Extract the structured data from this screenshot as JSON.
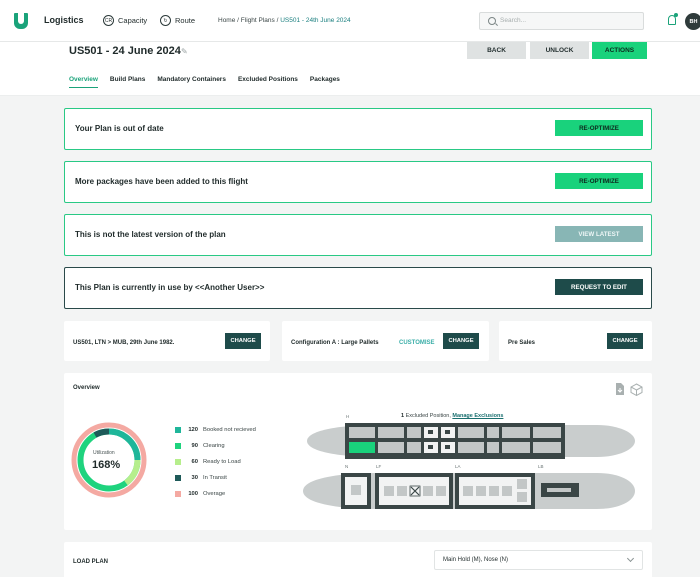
{
  "nav": {
    "app_name": "Logistics",
    "links": [
      {
        "label": "Capacity",
        "icon": "capacity-icon"
      },
      {
        "label": "Route",
        "icon": "route-icon"
      }
    ],
    "breadcrumb": {
      "home": "Home",
      "sep": "/",
      "flight_plans": "Flight Plans",
      "current": "US501 - 24th June 2024"
    },
    "search_placeholder": "Search...",
    "avatar_initials": "BH"
  },
  "header": {
    "title": "US501 - 24 June 2024",
    "buttons": {
      "back": "BACK",
      "unlock": "UNLOCK",
      "actions": "ACTIONS"
    },
    "tabs": [
      "Overview",
      "Build Plans",
      "Mandatory Containers",
      "Excluded Positions",
      "Packages"
    ],
    "active_tab": "Overview"
  },
  "banners": [
    {
      "message": "Your Plan is out of date",
      "action": "RE-OPTIMIZE"
    },
    {
      "message": "More packages have been added to this flight",
      "action": "RE-OPTIMIZE"
    },
    {
      "message": "This is not the latest version of the plan",
      "action": "VIEW LATEST"
    },
    {
      "message": "This Plan is currently in use by <<Another User>>",
      "action": "REQUEST TO EDIT"
    }
  ],
  "info_cards": {
    "flight": {
      "text": "US501, LTN > MUB, 29th June 1982.",
      "button": "CHANGE"
    },
    "configuration": {
      "text": "Configuration A : Large Pallets",
      "link": "CUSTOMISE",
      "button": "CHANGE"
    },
    "pre_sales": {
      "text": "Pre Sales",
      "button": "CHANGE"
    }
  },
  "overview": {
    "title": "Overview",
    "utilization_label": "Utilization",
    "utilization_value": "168%",
    "legend": [
      {
        "count": "120",
        "label": "Booked not recieved",
        "color": "#1fb69a"
      },
      {
        "count": "90",
        "label": "Clearing",
        "color": "#1fd37e"
      },
      {
        "count": "60",
        "label": "Ready to Load",
        "color": "#b6ee8c"
      },
      {
        "count": "30",
        "label": "In Transit",
        "color": "#1e5a59"
      },
      {
        "count": "100",
        "label": "Overage",
        "color": "#f4a9a2"
      }
    ],
    "excluded_count": "1",
    "excluded_text": "Excluded Position,",
    "manage_exclusions": "Manage Exclusions",
    "deck_labels": {
      "upper": "H",
      "n": "N",
      "lf": "LF",
      "la": "LA",
      "lb": "LB"
    }
  },
  "load_plan": {
    "title": "LOAD PLAN",
    "select_value": "Main Hold (M), Nose (N)"
  }
}
